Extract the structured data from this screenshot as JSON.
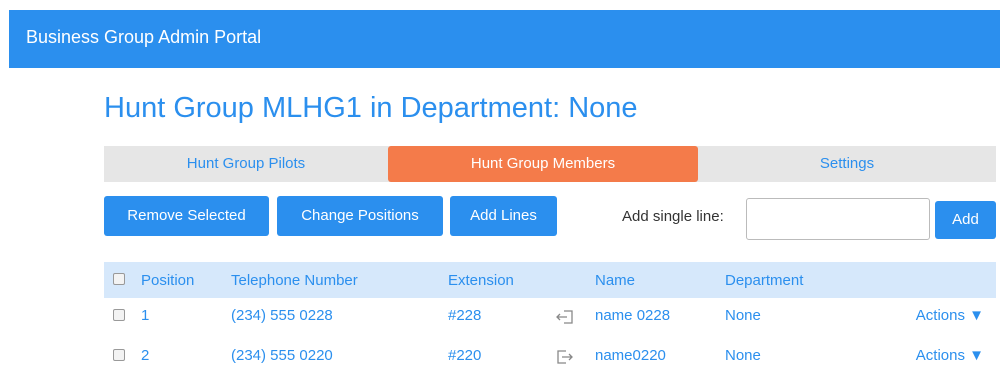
{
  "header": {
    "title": "Business Group Admin Portal"
  },
  "page": {
    "title": "Hunt Group MLHG1 in Department: None"
  },
  "tabs": [
    {
      "label": "Hunt Group Pilots",
      "active": false
    },
    {
      "label": "Hunt Group Members",
      "active": true
    },
    {
      "label": "Settings",
      "active": false
    }
  ],
  "toolbar": {
    "remove_label": "Remove Selected",
    "change_label": "Change Positions",
    "add_lines_label": "Add Lines",
    "single_line_label": "Add single line:",
    "single_line_value": "",
    "add_label": "Add"
  },
  "table": {
    "columns": [
      "Position",
      "Telephone Number",
      "Extension",
      "Name",
      "Department"
    ],
    "rows": [
      {
        "position": "1",
        "telephone": "(234) 555 0228",
        "extension": "#228",
        "icon": "sign-in-icon",
        "name": "name 0228",
        "department": "None",
        "actions": "Actions ▼"
      },
      {
        "position": "2",
        "telephone": "(234) 555 0220",
        "extension": "#220",
        "icon": "sign-out-icon",
        "name": "name0220",
        "department": "None",
        "actions": "Actions ▼"
      }
    ]
  },
  "colors": {
    "primary": "#2b8fee",
    "active_tab": "#f47b4a",
    "header_row": "#d6e8fb",
    "tab_bg": "#e6e6e6"
  }
}
